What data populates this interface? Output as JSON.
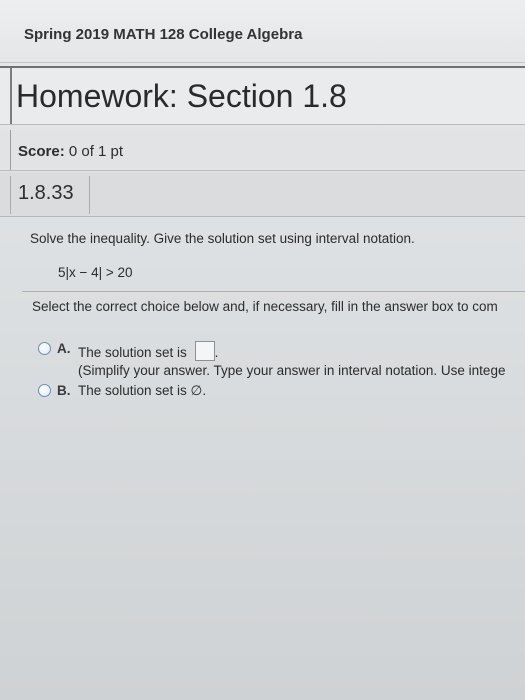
{
  "course": {
    "title": "Spring 2019 MATH 128 College Algebra"
  },
  "homework": {
    "title": "Homework: Section 1.8"
  },
  "score": {
    "label": "Score:",
    "value": "0 of 1 pt"
  },
  "question": {
    "number": "1.8.33",
    "prompt": "Solve the inequality. Give the solution set using interval notation.",
    "equation": "5|x − 4| > 20",
    "instruction": "Select the correct choice below and, if necessary, fill in the answer box to com",
    "choices": [
      {
        "letter": "A.",
        "text": "The solution set is",
        "after_box": ".",
        "hint": "(Simplify your answer. Type your answer in interval notation. Use intege"
      },
      {
        "letter": "B.",
        "text": "The solution set is ∅."
      }
    ]
  }
}
